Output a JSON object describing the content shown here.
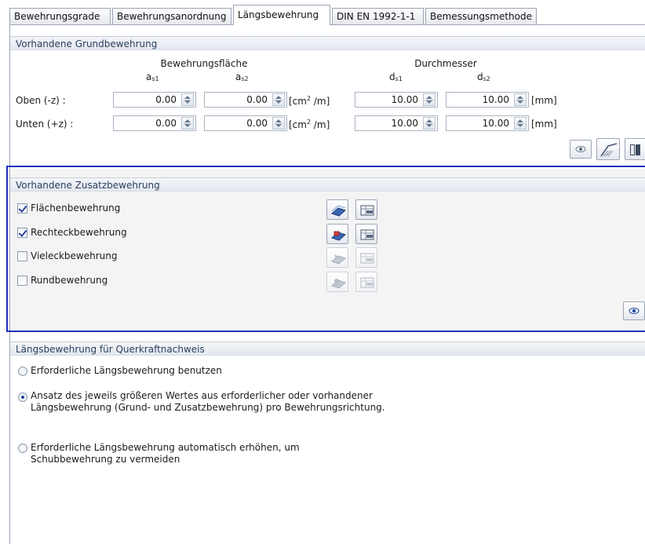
{
  "tabs": [
    {
      "label": "Bewehrungsgrade",
      "active": false
    },
    {
      "label": "Bewehrungsanordnung",
      "active": false
    },
    {
      "label": "Längsbewehrung",
      "active": true
    },
    {
      "label": "DIN EN 1992-1-1",
      "active": false
    },
    {
      "label": "Bemessungsmethode",
      "active": false
    }
  ],
  "grund": {
    "title": "Vorhandene Grundbewehrung",
    "area_header": "Bewehrungsfläche",
    "diam_header": "Durchmesser",
    "col_as": "a",
    "col_ds": "d",
    "sub_s1": "s1",
    "sub_s2": "s2",
    "rows": [
      {
        "label": "Oben (-z) :",
        "as1": "0.00",
        "as2": "0.00",
        "ds1": "10.00",
        "ds2": "10.00"
      },
      {
        "label": "Unten (+z) :",
        "as1": "0.00",
        "as2": "0.00",
        "ds1": "10.00",
        "ds2": "10.00"
      }
    ],
    "unit_area_pre": "[cm",
    "unit_area_sup": "2",
    "unit_area_post": " /m]",
    "unit_mm": "[mm]"
  },
  "zusatz": {
    "title": "Vorhandene Zusatzbewehrung",
    "items": [
      {
        "label": "Flächenbewehrung",
        "checked": true
      },
      {
        "label": "Rechteckbewehrung",
        "checked": true
      },
      {
        "label": "Vieleckbewehrung",
        "checked": false
      },
      {
        "label": "Rundbewehrung",
        "checked": false
      }
    ]
  },
  "laengs": {
    "title": "Längsbewehrung für Querkraftnachweis",
    "opt1": "Erforderliche Längsbewehrung benutzen",
    "opt2_l1": "Ansatz des jeweils größeren Wertes aus erforderlicher oder vorhandener",
    "opt2_l2": "Längsbewehrung (Grund- und Zusatzbewehrung) pro Bewehrungsrichtung.",
    "opt3_l1": "Erforderliche Längsbewehrung automatisch erhöhen, um",
    "opt3_l2": "Schubbewehrung zu vermeiden",
    "selected": 2
  },
  "colors": {
    "selection_frame": "#1d2fc2",
    "header_text": "#2a3f5f"
  }
}
